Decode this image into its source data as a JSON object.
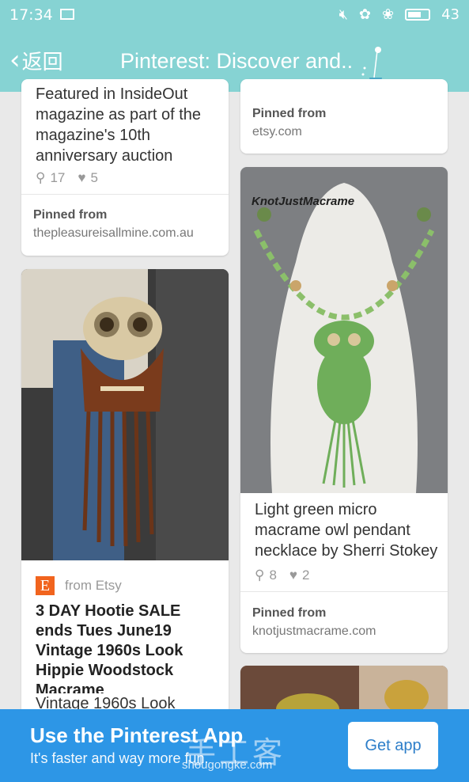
{
  "status_bar": {
    "time": "17:34",
    "battery": "43"
  },
  "title_bar": {
    "back_label": "返回",
    "title": "Pinterest: Discover and.."
  },
  "left_col": {
    "card1": {
      "text_lines": [
        "Featured in InsideOut",
        "magazine as part of the",
        "magazine's 10th",
        "anniversary auction"
      ],
      "repins": "17",
      "likes": "5",
      "pinned_label": "Pinned from",
      "source": "thepleasureisallmine.com.au"
    },
    "card2": {
      "from_label": "from Etsy",
      "etsy_letter": "E",
      "title_lines": [
        "3 DAY Hootie SALE",
        "ends Tues June19",
        "Vintage 1960s Look",
        "Hippie Woodstock",
        "Macrame"
      ],
      "desc_line": "Vintage 1960s Look"
    }
  },
  "right_col": {
    "card1": {
      "pinned_label": "Pinned from",
      "source": "etsy.com"
    },
    "card2": {
      "image_caption": "KnotJustMacrame",
      "text_lines": [
        "Light green micro",
        "macrame owl pendant",
        "necklace by Sherri Stokey"
      ],
      "repins": "8",
      "likes": "2",
      "pinned_label": "Pinned from",
      "source": "knotjustmacrame.com"
    }
  },
  "banner": {
    "heading": "Use the Pinterest App",
    "subtext": "It's faster and way more fun.",
    "button": "Get app",
    "watermark": "手工客",
    "watermark_url": "shougongke.com"
  },
  "colors": {
    "header": "#86d3d3",
    "banner": "#2d96e6",
    "etsy": "#f1641e"
  }
}
